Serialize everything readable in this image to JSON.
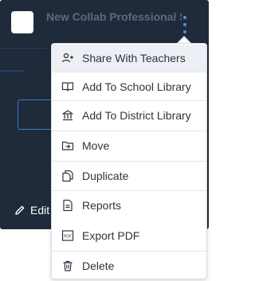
{
  "card": {
    "title": "New Collab Professional Services",
    "edit_label": "Edit"
  },
  "menu": {
    "items": [
      {
        "label": "Share With Teachers",
        "icon": "share-teachers-icon"
      },
      {
        "label": "Add To School Library",
        "icon": "book-icon"
      },
      {
        "label": "Add To District Library",
        "icon": "institution-icon"
      },
      {
        "label": "Move",
        "icon": "folder-move-icon"
      },
      {
        "label": "Duplicate",
        "icon": "copy-icon"
      },
      {
        "label": "Reports",
        "icon": "report-icon"
      },
      {
        "label": "Export PDF",
        "icon": "pdf-icon"
      },
      {
        "label": "Delete",
        "icon": "trash-icon"
      }
    ]
  },
  "colors": {
    "card_bg": "#1f2a3a",
    "accent": "#4a90e2",
    "menu_hover": "#eceff3"
  }
}
